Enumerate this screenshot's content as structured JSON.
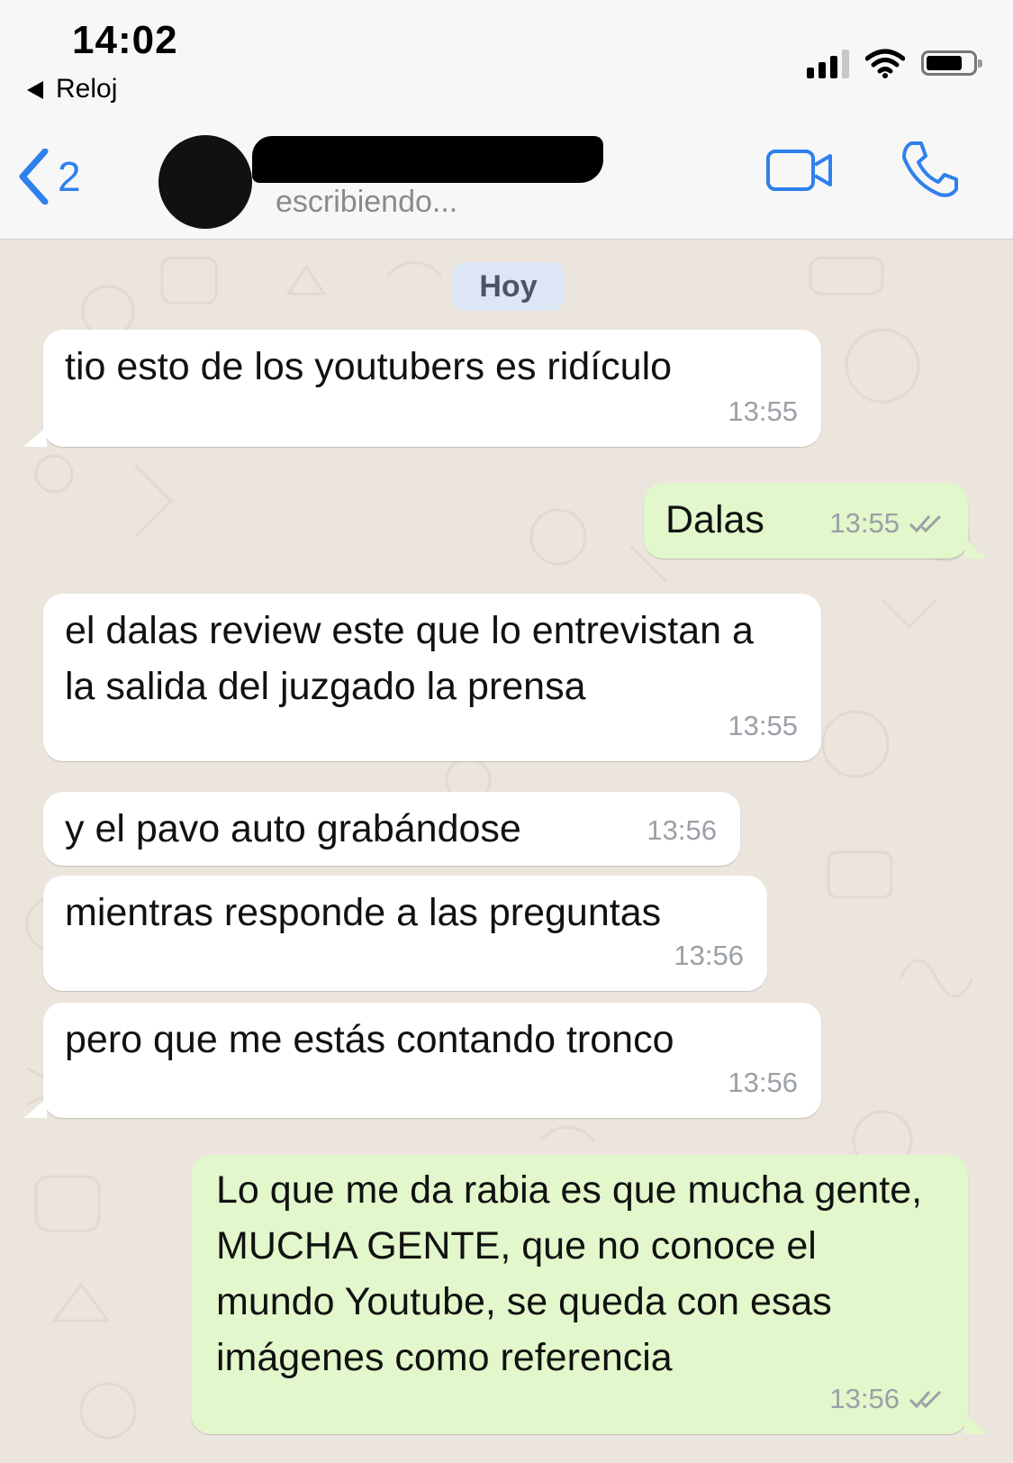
{
  "status_bar": {
    "time": "14:02",
    "back_app": "Reloj"
  },
  "header": {
    "back_count": "2",
    "subtitle": "escribiendo...",
    "accent_color": "#2f80ed"
  },
  "chat": {
    "date_label": "Hoy",
    "messages": [
      {
        "text": "tio esto de los youtubers es ridículo",
        "time": "13:55"
      },
      {
        "text": "Dalas",
        "time": "13:55"
      },
      {
        "text": "el dalas review este que lo entrevistan a la salida del juzgado la prensa",
        "time": "13:55"
      },
      {
        "text": "y el pavo auto grabándose",
        "time": "13:56"
      },
      {
        "text": "mientras responde a las preguntas",
        "time": "13:56"
      },
      {
        "text": "pero que me estás contando tronco",
        "time": "13:56"
      },
      {
        "text": "Lo que me da rabia es que mucha gente, MUCHA GENTE, que no conoce el mundo Youtube, se queda con esas imágenes como referencia",
        "time": "13:56"
      }
    ]
  }
}
